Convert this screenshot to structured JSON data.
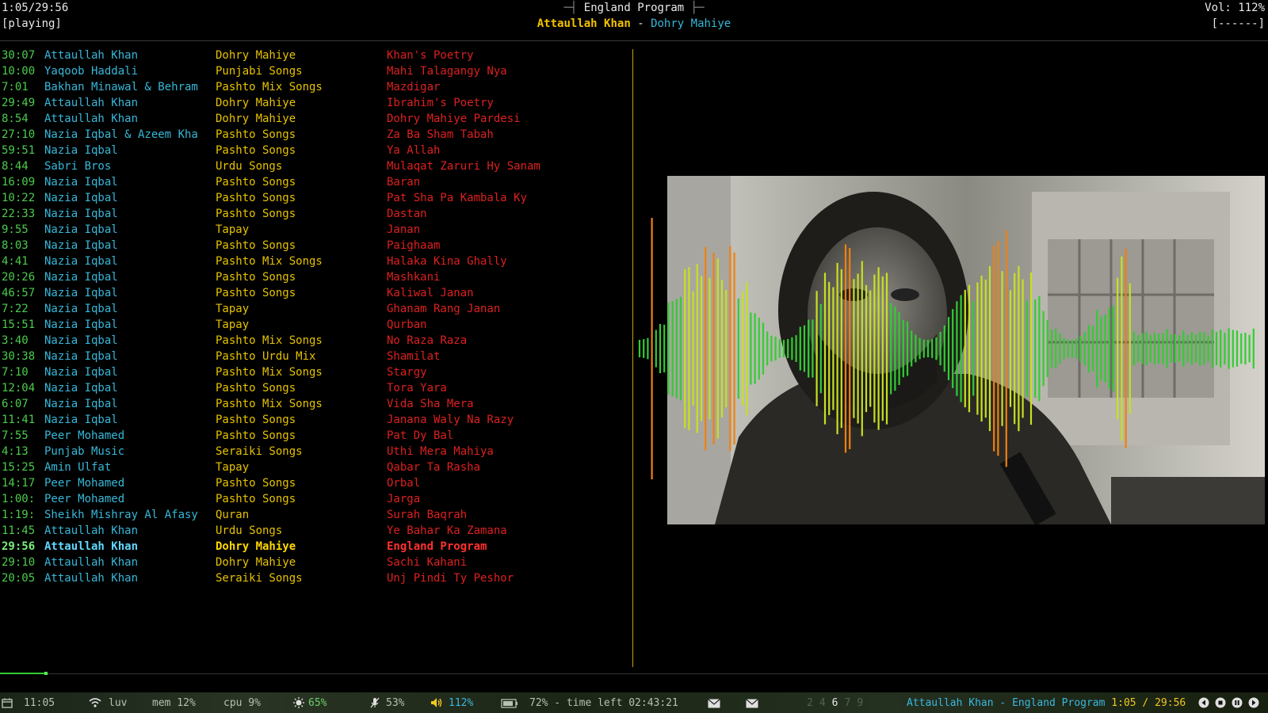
{
  "header": {
    "time": "1:05/29:56",
    "state": "[playing]",
    "title": "England Program",
    "artist": "Attaullah Khan",
    "separator": "-",
    "album": "Dohry Mahiye",
    "volume": "Vol: 112%",
    "volume_bar": "[------]"
  },
  "playlist": [
    {
      "time": "30:07",
      "artist": "Attaullah Khan",
      "album": "Dohry Mahiye",
      "title": "Khan's Poetry"
    },
    {
      "time": "10:00",
      "artist": "Yaqoob Haddali",
      "album": "Punjabi Songs",
      "title": "Mahi Talagangy Nya"
    },
    {
      "time": "7:01",
      "artist": "Bakhan Minawal & Behram",
      "album": "Pashto Mix Songs",
      "title": "Mazdigar"
    },
    {
      "time": "29:49",
      "artist": "Attaullah Khan",
      "album": "Dohry Mahiye",
      "title": "Ibrahim's Poetry"
    },
    {
      "time": "8:54",
      "artist": "Attaullah Khan",
      "album": "Dohry Mahiye",
      "title": "Dohry Mahiye Pardesi"
    },
    {
      "time": "27:10",
      "artist": "Nazia Iqbal & Azeem Kha",
      "album": "Pashto Songs",
      "title": "Za Ba Sham Tabah"
    },
    {
      "time": "59:51",
      "artist": "Nazia Iqbal",
      "album": "Pashto Songs",
      "title": "Ya Allah"
    },
    {
      "time": "8:44",
      "artist": "Sabri Bros",
      "album": "Urdu Songs",
      "title": "Mulaqat Zaruri Hy Sanam"
    },
    {
      "time": "16:09",
      "artist": "Nazia Iqbal",
      "album": "Pashto Songs",
      "title": "Baran"
    },
    {
      "time": "10:22",
      "artist": "Nazia Iqbal",
      "album": "Pashto Songs",
      "title": "Pat Sha Pa Kambala Ky"
    },
    {
      "time": "22:33",
      "artist": "Nazia Iqbal",
      "album": "Pashto Songs",
      "title": "Dastan"
    },
    {
      "time": "9:55",
      "artist": "Nazia Iqbal",
      "album": "Tapay",
      "title": "Janan"
    },
    {
      "time": "8:03",
      "artist": "Nazia Iqbal",
      "album": "Pashto Songs",
      "title": "Paighaam"
    },
    {
      "time": "4:41",
      "artist": "Nazia Iqbal",
      "album": "Pashto Mix Songs",
      "title": "Halaka Kina Ghally"
    },
    {
      "time": "20:26",
      "artist": "Nazia Iqbal",
      "album": "Pashto Songs",
      "title": "Mashkani"
    },
    {
      "time": "46:57",
      "artist": "Nazia Iqbal",
      "album": "Pashto Songs",
      "title": "Kaliwal Janan"
    },
    {
      "time": "7:22",
      "artist": "Nazia Iqbal",
      "album": "Tapay",
      "title": "Ghanam Rang Janan"
    },
    {
      "time": "15:51",
      "artist": "Nazia Iqbal",
      "album": "Tapay",
      "title": "Qurban"
    },
    {
      "time": "3:40",
      "artist": "Nazia Iqbal",
      "album": "Pashto Mix Songs",
      "title": "No Raza Raza"
    },
    {
      "time": "30:38",
      "artist": "Nazia Iqbal",
      "album": "Pashto Urdu Mix",
      "title": "Shamilat"
    },
    {
      "time": "7:10",
      "artist": "Nazia Iqbal",
      "album": "Pashto Mix Songs",
      "title": "Stargy"
    },
    {
      "time": "12:04",
      "artist": "Nazia Iqbal",
      "album": "Pashto Songs",
      "title": "Tora Yara"
    },
    {
      "time": "6:07",
      "artist": "Nazia Iqbal",
      "album": "Pashto Mix Songs",
      "title": "Vida Sha Mera"
    },
    {
      "time": "11:41",
      "artist": "Nazia Iqbal",
      "album": "Pashto Songs",
      "title": "Janana Waly Na Razy"
    },
    {
      "time": "7:55",
      "artist": "Peer Mohamed",
      "album": "Pashto Songs",
      "title": "Pat Dy Bal"
    },
    {
      "time": "4:13",
      "artist": "Punjab Music",
      "album": "Seraiki Songs",
      "title": "Uthi Mera Mahiya"
    },
    {
      "time": "15:25",
      "artist": "Amin Ulfat",
      "album": "Tapay",
      "title": "Qabar Ta Rasha"
    },
    {
      "time": "14:17",
      "artist": "Peer Mohamed",
      "album": "Pashto Songs",
      "title": "Orbal"
    },
    {
      "time": "1:00:",
      "artist": "Peer Mohamed",
      "album": "Pashto Songs",
      "title": "Jarga"
    },
    {
      "time": "1:19:",
      "artist": "Sheikh Mishray Al Afasy",
      "album": "Quran",
      "title": "Surah Baqrah"
    },
    {
      "time": "11:45",
      "artist": "Attaullah Khan",
      "album": "Urdu Songs",
      "title": "Ye Bahar Ka Zamana"
    },
    {
      "time": "29:56",
      "artist": "Attaullah Khan",
      "album": "Dohry Mahiye",
      "title": "England Program",
      "current": true
    },
    {
      "time": "29:10",
      "artist": "Attaullah Khan",
      "album": "Dohry Mahiye",
      "title": "Sachi Kahani"
    },
    {
      "time": "20:05",
      "artist": "Attaullah Khan",
      "album": "Seraiki Songs",
      "title": "Unj Pindi Ty Peshor"
    }
  ],
  "progress": {
    "fraction": 0.036
  },
  "statusbar": {
    "clock": "11:05",
    "wifi": "luv",
    "mem": "mem 12%",
    "cpu": "cpu 9%",
    "brightness": "65%",
    "mic": "53%",
    "volume": "112%",
    "battery": "72% - time left 02:43:21",
    "workspaces": [
      "2",
      "4",
      "6",
      "7",
      "9"
    ],
    "active_workspace": "6",
    "now_playing_artist": "Attaullah Khan",
    "now_playing_sep": " - ",
    "now_playing_title": "England Program",
    "now_playing_time": "1:05 / 29:56",
    "icons": [
      "calendar-icon",
      "wifi-icon",
      "brightness-icon",
      "mic-icon",
      "speaker-icon",
      "battery-icon",
      "mail-icon",
      "mail-icon",
      "prev-icon",
      "stop-icon",
      "pause-icon",
      "next-icon"
    ]
  },
  "colors": {
    "time": "#4ccc4c",
    "artist": "#36b8d8",
    "album": "#e6c200",
    "title": "#dd2020",
    "visualizer_green": "#33cc33",
    "visualizer_yellow": "#c8e020",
    "visualizer_orange": "#f08010"
  }
}
